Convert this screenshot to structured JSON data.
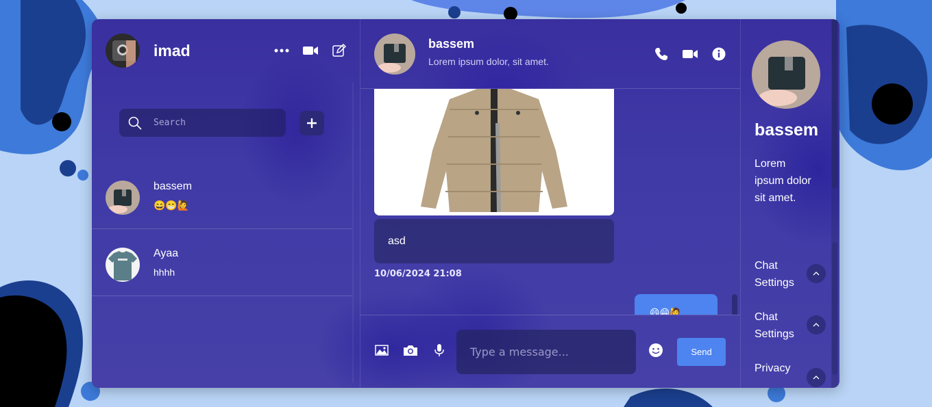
{
  "colors": {
    "accent": "#4d84f0",
    "panel": "#3f3aa6",
    "background": "#b9d4f6"
  },
  "current_user": {
    "name": "imad",
    "avatar_icon": "watch-photo"
  },
  "left_tools": [
    "more-icon",
    "video-icon",
    "compose-icon"
  ],
  "search": {
    "placeholder": "Search"
  },
  "contacts": [
    {
      "name": "bassem",
      "last_message": "😄😁🙋",
      "avatar_icon": "wallet-photo"
    },
    {
      "name": "Ayaa",
      "last_message": "hhhh",
      "avatar_icon": "tshirt-photo"
    }
  ],
  "chat": {
    "name": "bassem",
    "status": "Lorem ipsum dolor, sit amet.",
    "tools": [
      "phone-icon",
      "video-icon",
      "info-icon"
    ],
    "messages": [
      {
        "type": "image",
        "alt": "jacket-photo"
      },
      {
        "type": "text",
        "text": "asd",
        "time": "10/06/2024 21:08"
      },
      {
        "type": "text-own",
        "text": "😄😁🙋"
      }
    ]
  },
  "composer": {
    "placeholder": "Type a message...",
    "send_label": "Send"
  },
  "details": {
    "name": "bassem",
    "description": "Lorem ipsum dolor sit amet.",
    "items": [
      {
        "label": "Chat Settings"
      },
      {
        "label": "Chat Settings"
      },
      {
        "label": "Privacy"
      }
    ]
  }
}
